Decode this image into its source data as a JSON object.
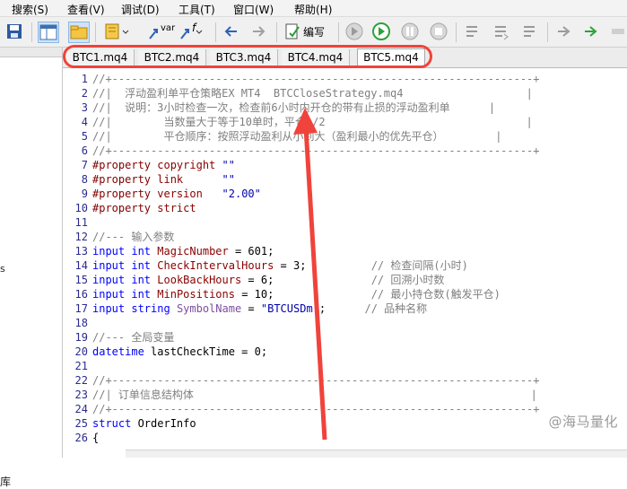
{
  "menu": {
    "items": [
      "搜索(S)",
      "查看(V)",
      "调试(D)",
      "工具(T)",
      "窗口(W)",
      "帮助(H)"
    ]
  },
  "toolbar": {
    "var_label": "var",
    "fx_label": "f",
    "compile_label": "编写"
  },
  "left_panel": {
    "fragment_s": "s",
    "fragment_lib": "库"
  },
  "tabs": [
    {
      "label": "BTC1.mq4",
      "active": false
    },
    {
      "label": "BTC2.mq4",
      "active": false
    },
    {
      "label": "BTC3.mq4",
      "active": false
    },
    {
      "label": "BTC4.mq4",
      "active": false
    },
    {
      "label": "BTC5.mq4",
      "active": true
    }
  ],
  "code_lines": [
    {
      "n": "1",
      "segs": [
        {
          "t": "//+-----------------------------------------------------------------+",
          "c": "comment"
        }
      ]
    },
    {
      "n": "2",
      "segs": [
        {
          "t": "//|  浮动盈利单平仓策略EX MT4  BTCCloseStrategy.mq4                   |",
          "c": "comment"
        }
      ]
    },
    {
      "n": "3",
      "segs": [
        {
          "t": "//|  说明：3小时检查一次，检查前6小时内开仓的带有止损的浮动盈利单      |",
          "c": "comment"
        }
      ]
    },
    {
      "n": "4",
      "segs": [
        {
          "t": "//|        当数量大于等于10单时，平仓1/2                               |",
          "c": "comment"
        }
      ]
    },
    {
      "n": "5",
      "segs": [
        {
          "t": "//|        平仓顺序：按照浮动盈利从小到大（盈利最小的优先平仓）        |",
          "c": "comment"
        }
      ]
    },
    {
      "n": "6",
      "segs": [
        {
          "t": "//+-----------------------------------------------------------------+",
          "c": "comment"
        }
      ]
    },
    {
      "n": "7",
      "segs": [
        {
          "t": "#property ",
          "c": "prop"
        },
        {
          "t": "copyright",
          "c": "ident"
        },
        {
          "t": " ",
          "c": "plain"
        },
        {
          "t": "\"\"",
          "c": "string"
        }
      ]
    },
    {
      "n": "8",
      "segs": [
        {
          "t": "#property ",
          "c": "prop"
        },
        {
          "t": "link",
          "c": "ident"
        },
        {
          "t": "      ",
          "c": "plain"
        },
        {
          "t": "\"\"",
          "c": "string"
        }
      ]
    },
    {
      "n": "9",
      "segs": [
        {
          "t": "#property ",
          "c": "prop"
        },
        {
          "t": "version",
          "c": "ident"
        },
        {
          "t": "   ",
          "c": "plain"
        },
        {
          "t": "\"2.00\"",
          "c": "string"
        }
      ]
    },
    {
      "n": "10",
      "segs": [
        {
          "t": "#property ",
          "c": "prop"
        },
        {
          "t": "strict",
          "c": "ident"
        }
      ]
    },
    {
      "n": "11",
      "segs": []
    },
    {
      "n": "12",
      "segs": [
        {
          "t": "//--- 输入参数",
          "c": "comment"
        }
      ]
    },
    {
      "n": "13",
      "segs": [
        {
          "t": "input ",
          "c": "keyword"
        },
        {
          "t": "int ",
          "c": "keyword"
        },
        {
          "t": "MagicNumber",
          "c": "ident"
        },
        {
          "t": " = 601;",
          "c": "plain"
        }
      ]
    },
    {
      "n": "14",
      "segs": [
        {
          "t": "input ",
          "c": "keyword"
        },
        {
          "t": "int ",
          "c": "keyword"
        },
        {
          "t": "CheckIntervalHours",
          "c": "ident"
        },
        {
          "t": " = 3;          ",
          "c": "plain"
        },
        {
          "t": "// 检查间隔(小时)",
          "c": "comment"
        }
      ]
    },
    {
      "n": "15",
      "segs": [
        {
          "t": "input ",
          "c": "keyword"
        },
        {
          "t": "int ",
          "c": "keyword"
        },
        {
          "t": "LookBackHours",
          "c": "ident"
        },
        {
          "t": " = 6;               ",
          "c": "plain"
        },
        {
          "t": "// 回溯小时数",
          "c": "comment"
        }
      ]
    },
    {
      "n": "16",
      "segs": [
        {
          "t": "input ",
          "c": "keyword"
        },
        {
          "t": "int ",
          "c": "keyword"
        },
        {
          "t": "MinPositions",
          "c": "ident"
        },
        {
          "t": " = 10;               ",
          "c": "plain"
        },
        {
          "t": "// 最小持仓数(触发平仓)",
          "c": "comment"
        }
      ]
    },
    {
      "n": "17",
      "segs": [
        {
          "t": "input ",
          "c": "keyword"
        },
        {
          "t": "string ",
          "c": "keyword"
        },
        {
          "t": "SymbolName",
          "c": "const"
        },
        {
          "t": " = ",
          "c": "plain"
        },
        {
          "t": "\"BTCUSDm\"",
          "c": "string"
        },
        {
          "t": ";      ",
          "c": "plain"
        },
        {
          "t": "// 品种名称",
          "c": "comment"
        }
      ]
    },
    {
      "n": "18",
      "segs": []
    },
    {
      "n": "19",
      "segs": [
        {
          "t": "//--- 全局变量",
          "c": "comment"
        }
      ]
    },
    {
      "n": "20",
      "segs": [
        {
          "t": "datetime ",
          "c": "keyword"
        },
        {
          "t": "lastCheckTime = 0;",
          "c": "plain"
        }
      ]
    },
    {
      "n": "21",
      "segs": []
    },
    {
      "n": "22",
      "segs": [
        {
          "t": "//+-----------------------------------------------------------------+",
          "c": "comment"
        }
      ]
    },
    {
      "n": "23",
      "segs": [
        {
          "t": "//| 订单信息结构体                                                    |",
          "c": "comment"
        }
      ]
    },
    {
      "n": "24",
      "segs": [
        {
          "t": "//+-----------------------------------------------------------------+",
          "c": "comment"
        }
      ]
    },
    {
      "n": "25",
      "segs": [
        {
          "t": "struct ",
          "c": "keyword"
        },
        {
          "t": "OrderInfo",
          "c": "plain"
        }
      ]
    },
    {
      "n": "26",
      "segs": [
        {
          "t": "{",
          "c": "plain"
        }
      ]
    }
  ],
  "watermark": "@海马量化",
  "colors": {
    "highlight": "#f0433b",
    "keyword": "#0000ff",
    "comment": "#7f7f7f"
  }
}
